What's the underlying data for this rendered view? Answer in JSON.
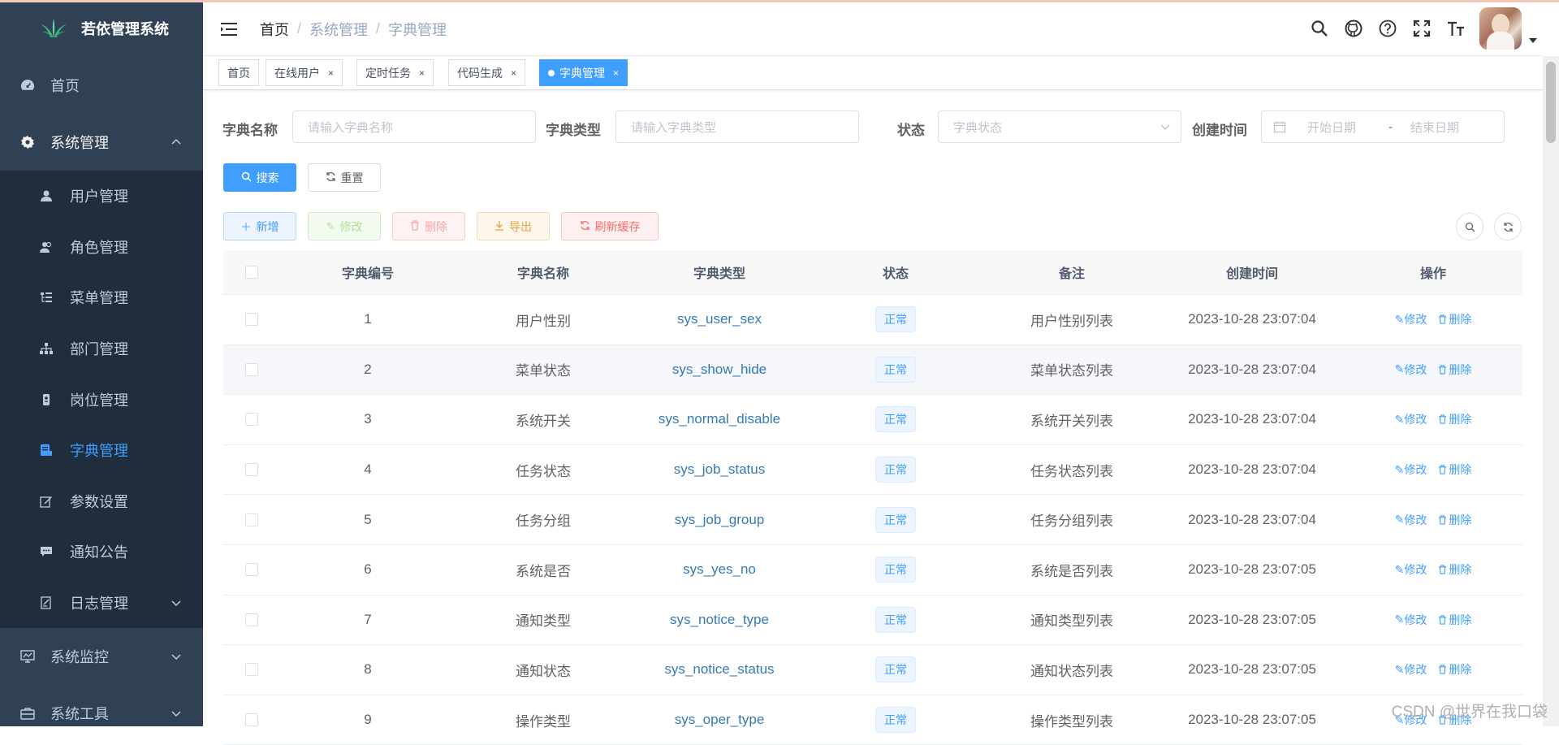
{
  "app": {
    "title": "若依管理系统"
  },
  "sidebar": {
    "items": [
      {
        "label": "首页",
        "icon": "dashboard-icon"
      },
      {
        "label": "系统管理",
        "icon": "gear-icon",
        "expanded": true,
        "children": [
          {
            "label": "用户管理",
            "icon": "user-icon"
          },
          {
            "label": "角色管理",
            "icon": "peoples-icon"
          },
          {
            "label": "菜单管理",
            "icon": "tree-table-icon"
          },
          {
            "label": "部门管理",
            "icon": "tree-icon"
          },
          {
            "label": "岗位管理",
            "icon": "post-icon"
          },
          {
            "label": "字典管理",
            "icon": "dict-icon",
            "active": true
          },
          {
            "label": "参数设置",
            "icon": "edit-icon"
          },
          {
            "label": "通知公告",
            "icon": "message-icon"
          },
          {
            "label": "日志管理",
            "icon": "log-icon"
          }
        ]
      },
      {
        "label": "系统监控",
        "icon": "monitor-icon"
      },
      {
        "label": "系统工具",
        "icon": "tool-icon"
      }
    ]
  },
  "breadcrumb": [
    "首页",
    "系统管理",
    "字典管理"
  ],
  "tags": [
    "首页",
    "在线用户",
    "定时任务",
    "代码生成",
    "字典管理"
  ],
  "search": {
    "dict_name_label": "字典名称",
    "dict_name_placeholder": "请输入字典名称",
    "dict_type_label": "字典类型",
    "dict_type_placeholder": "请输入字典类型",
    "status_label": "状态",
    "status_placeholder": "字典状态",
    "created_label": "创建时间",
    "start_placeholder": "开始日期",
    "range_sep": "-",
    "end_placeholder": "结束日期",
    "search_btn": "搜索",
    "reset_btn": "重置"
  },
  "toolbar": {
    "add": "新增",
    "edit": "修改",
    "delete": "删除",
    "export": "导出",
    "refresh_cache": "刷新缓存"
  },
  "table": {
    "headers": [
      "字典编号",
      "字典名称",
      "字典类型",
      "状态",
      "备注",
      "创建时间",
      "操作"
    ],
    "rows": [
      {
        "id": "1",
        "name": "用户性别",
        "type": "sys_user_sex",
        "status": "正常",
        "remark": "用户性别列表",
        "created": "2023-10-28 23:07:04"
      },
      {
        "id": "2",
        "name": "菜单状态",
        "type": "sys_show_hide",
        "status": "正常",
        "remark": "菜单状态列表",
        "created": "2023-10-28 23:07:04"
      },
      {
        "id": "3",
        "name": "系统开关",
        "type": "sys_normal_disable",
        "status": "正常",
        "remark": "系统开关列表",
        "created": "2023-10-28 23:07:04"
      },
      {
        "id": "4",
        "name": "任务状态",
        "type": "sys_job_status",
        "status": "正常",
        "remark": "任务状态列表",
        "created": "2023-10-28 23:07:04"
      },
      {
        "id": "5",
        "name": "任务分组",
        "type": "sys_job_group",
        "status": "正常",
        "remark": "任务分组列表",
        "created": "2023-10-28 23:07:04"
      },
      {
        "id": "6",
        "name": "系统是否",
        "type": "sys_yes_no",
        "status": "正常",
        "remark": "系统是否列表",
        "created": "2023-10-28 23:07:05"
      },
      {
        "id": "7",
        "name": "通知类型",
        "type": "sys_notice_type",
        "status": "正常",
        "remark": "通知类型列表",
        "created": "2023-10-28 23:07:05"
      },
      {
        "id": "8",
        "name": "通知状态",
        "type": "sys_notice_status",
        "status": "正常",
        "remark": "通知状态列表",
        "created": "2023-10-28 23:07:05"
      },
      {
        "id": "9",
        "name": "操作类型",
        "type": "sys_oper_type",
        "status": "正常",
        "remark": "操作类型列表",
        "created": "2023-10-28 23:07:05"
      }
    ],
    "row_actions": {
      "edit": "修改",
      "delete": "删除"
    }
  },
  "watermark": "CSDN @世界在我口袋",
  "colors": {
    "sidebar_bg": "#304156",
    "submenu_bg": "#1f2d3d",
    "primary": "#409eff",
    "active_menu": "#409eff"
  }
}
